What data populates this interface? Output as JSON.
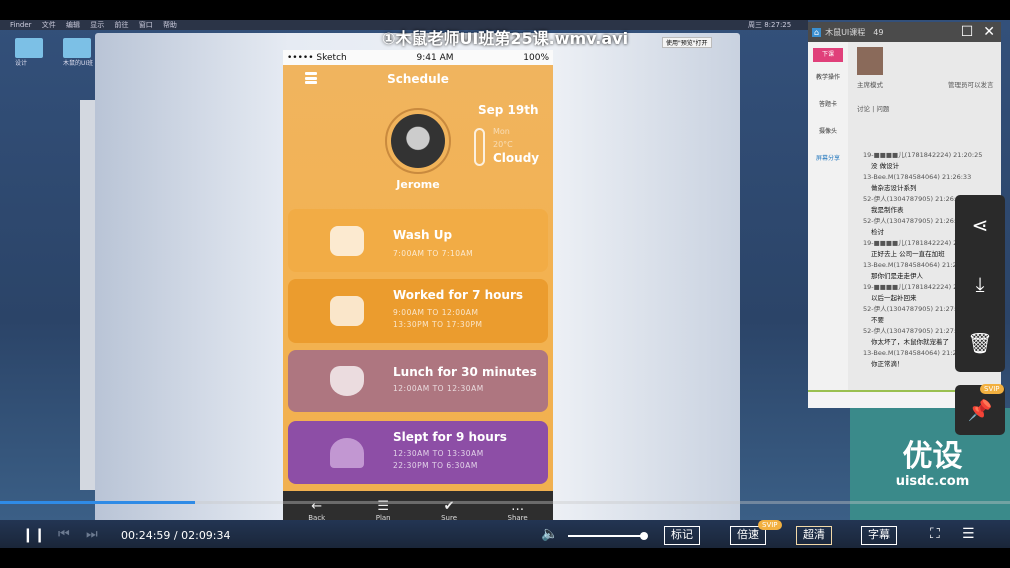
{
  "video": {
    "title": "①木鼠老师UI班第25课.wmv.avi",
    "current_time": "00:24:59",
    "total_time": "02:09:34",
    "progress": 0.193,
    "volume": 1.0
  },
  "mac_menu": {
    "items": [
      "Finder",
      "文件",
      "编辑",
      "显示",
      "前往",
      "窗口",
      "帮助"
    ],
    "clock": "周三 8:27:25",
    "open_with": "使用\"预览\"打开"
  },
  "desktop": {
    "icons": [
      "设计",
      "木鼠的UI班"
    ]
  },
  "phone": {
    "status": {
      "carrier": "••••• Sketch",
      "time": "9:41 AM",
      "battery": "100%"
    },
    "title": "Schedule",
    "user": "Jerome",
    "date": "Sep 19th",
    "weather": {
      "day": "Mon",
      "temp": "20°C",
      "condition": "Cloudy"
    },
    "cards": [
      {
        "title": "Wash Up",
        "times": [
          "7:00AM TO 7:10AM"
        ],
        "icon": "bathtub-icon",
        "color": "#f2ac45"
      },
      {
        "title": "Worked for 7 hours",
        "times": [
          "9:00AM TO 12:00AM",
          "13:30PM TO 17:30PM"
        ],
        "icon": "computer-icon",
        "color": "#eb9c2e"
      },
      {
        "title": "Lunch for 30 minutes",
        "times": [
          "12:00AM TO 12:30AM"
        ],
        "icon": "fork-knife-icon",
        "color": "#ae7680"
      },
      {
        "title": "Slept for 9 hours",
        "times": [
          "12:30AM TO 13:30AM",
          "22:30PM TO 6:30AM"
        ],
        "icon": "sleep-icon",
        "color": "#8d4ea6"
      }
    ],
    "tabs": [
      {
        "label": "Back",
        "icon": "←"
      },
      {
        "label": "Plan",
        "icon": "☰"
      },
      {
        "label": "Sure",
        "icon": "✔"
      },
      {
        "label": "Share",
        "icon": "…"
      }
    ]
  },
  "chat": {
    "window_title": "木鼠UI课程",
    "count": "49",
    "side": [
      "教学操作",
      "答题卡",
      "摄像头",
      "屏幕分享"
    ],
    "raise_hand": "下课",
    "mode": "主席模式",
    "manage": "管理员可以发言",
    "tabs": "讨论 | 问题",
    "messages": [
      {
        "user": "19-■■■■儿(1781842224) 21:20:25",
        "text": "没 做设计"
      },
      {
        "user": "13-Bee.M(1784584064) 21:26:33",
        "text": "做杂志设计系列"
      },
      {
        "user": "52-伊人(1304787905) 21:26:39",
        "text": "我是制作表"
      },
      {
        "user": "52-伊人(1304787905) 21:26:47",
        "text": "检讨"
      },
      {
        "user": "19-■■■■儿(1781842224) 21:26",
        "text": "正好去上 公司一直在加班"
      },
      {
        "user": "13-Bee.M(1784584064) 21:26",
        "text": "那你们是走走伊人"
      },
      {
        "user": "19-■■■■儿(1781842224) 21:26",
        "text": "以后一起补回来"
      },
      {
        "user": "52-伊人(1304787905) 21:27:01",
        "text": "不要"
      },
      {
        "user": "52-伊人(1304787905) 21:27:05",
        "text": "你太坏了，木鼠你就宠着了"
      },
      {
        "user": "13-Bee.M(1784584064) 21:27",
        "text": "你正常滴！"
      }
    ]
  },
  "watermark": {
    "brand": "优设",
    "url": "uisdc.com"
  },
  "side_actions": [
    "share-icon",
    "download-icon",
    "delete-icon"
  ],
  "pin": {
    "badge": "SVIP"
  },
  "controls": {
    "mark": "标记",
    "speed": "倍速",
    "speed_badge": "SVIP",
    "quality": "超清",
    "subtitle": "字幕"
  }
}
